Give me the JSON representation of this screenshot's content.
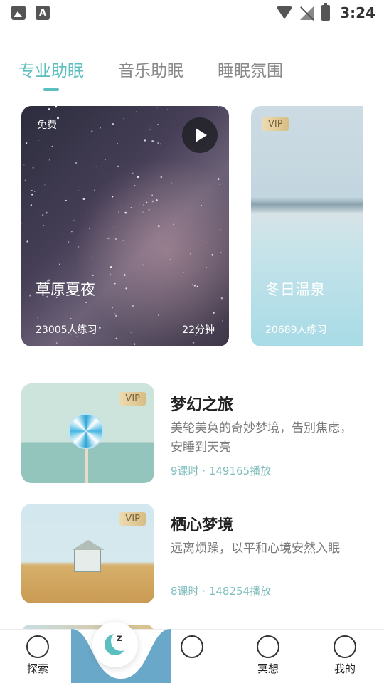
{
  "status_bar": {
    "time": "3:24"
  },
  "tabs": [
    {
      "label": "专业助眠",
      "active": true
    },
    {
      "label": "音乐助眠",
      "active": false
    },
    {
      "label": "睡眠氛围",
      "active": false
    }
  ],
  "featured": [
    {
      "badge": "免费",
      "title": "草原夏夜",
      "count": "23005人练习",
      "duration": "22分钟"
    },
    {
      "badge": "VIP",
      "title": "冬日温泉",
      "count": "20689人练习"
    }
  ],
  "courses": [
    {
      "badge": "VIP",
      "title": "梦幻之旅",
      "desc": "美轮美奂的奇妙梦境，告别焦虑，安睡到天亮",
      "meta": "9课时 · 149165播放"
    },
    {
      "badge": "VIP",
      "title": "栖心梦境",
      "desc": "远离烦躁，以平和心境安然入眠",
      "meta": "8课时 · 148254播放"
    }
  ],
  "bottom_nav": [
    {
      "label": "探索",
      "icon": "compass-icon"
    },
    {
      "label": "",
      "icon": "moon-sleep-icon"
    },
    {
      "label": "",
      "icon": "music-note-icon"
    },
    {
      "label": "冥想",
      "icon": "meditation-icon"
    },
    {
      "label": "我的",
      "icon": "face-icon"
    }
  ],
  "colors": {
    "accent": "#5bbfbf",
    "meta": "#7fbdbd",
    "vip_gold": "#d7bd84"
  }
}
